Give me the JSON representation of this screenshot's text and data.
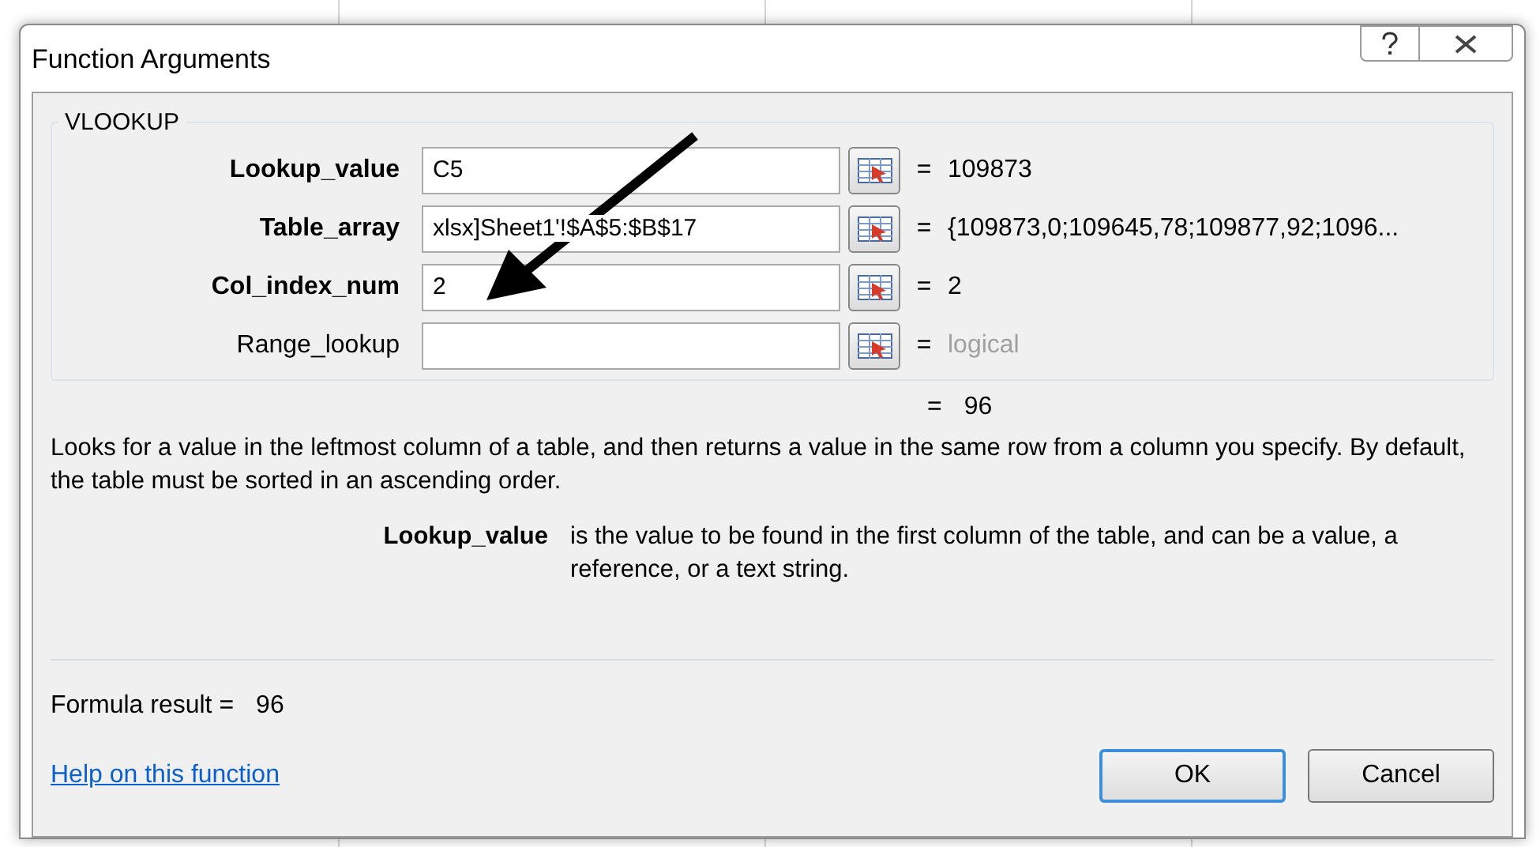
{
  "window": {
    "title": "Function Arguments"
  },
  "function": {
    "name": "VLOOKUP",
    "arguments": [
      {
        "label": "Lookup_value",
        "required": true,
        "value": "C5",
        "sign": "=",
        "result": "109873",
        "result_is_hint": false
      },
      {
        "label": "Table_array",
        "required": true,
        "value": "xlsx]Sheet1'!$A$5:$B$17",
        "sign": "=",
        "result": "{109873,0;109645,78;109877,92;1096...",
        "result_is_hint": false
      },
      {
        "label": "Col_index_num",
        "required": true,
        "value": "2",
        "sign": "=",
        "result": "2",
        "result_is_hint": false
      },
      {
        "label": "Range_lookup",
        "required": false,
        "sign": "=",
        "result": "logical",
        "result_is_hint": true
      }
    ],
    "result_sign": "=",
    "result": "96",
    "description": "Looks for a value in the leftmost column of a table, and then returns a value in the same row from a column you specify. By default, the table must be sorted in an ascending order.",
    "argument_help": {
      "label": "Lookup_value",
      "text": "is the value to be found in the first column of the table, and can be a value, a reference, or a text string."
    }
  },
  "formula_result": {
    "label": "Formula result =",
    "value": "96"
  },
  "help_link": "Help on this function",
  "buttons": [
    {
      "label": "OK",
      "default": true
    },
    {
      "label": "Cancel",
      "default": false
    }
  ]
}
